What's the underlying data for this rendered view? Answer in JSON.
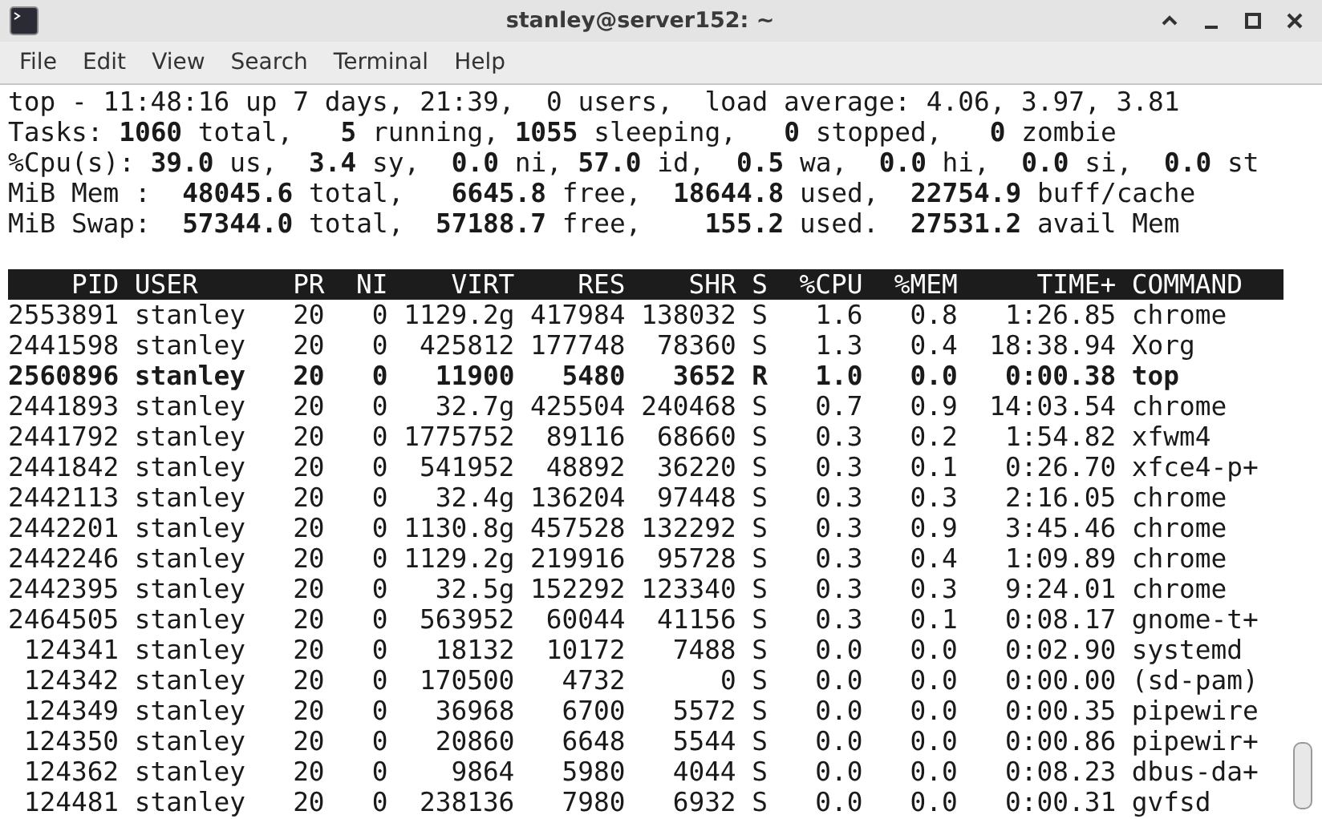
{
  "window": {
    "title": "stanley@server152: ~"
  },
  "menu": [
    "File",
    "Edit",
    "View",
    "Search",
    "Terminal",
    "Help"
  ],
  "summary": [
    "top - 11:48:16 up 7 days, 21:39,  0 users,  load average: 4.06, 3.97, 3.81",
    "Tasks: **1060** total,   **5** running, **1055** sleeping,   **0** stopped,   **0** zombie",
    "%Cpu(s): **39.0** us,  **3.4** sy,  **0.0** ni, **57.0** id,  **0.5** wa,  **0.0** hi,  **0.0** si,  **0.0** st",
    "MiB Mem :  **48045.6** total,   **6645.8** free,  **18644.8** used,  **22754.9** buff/cache",
    "MiB Swap:  **57344.0** total,  **57188.7** free,    **155.2** used.  **27531.2** avail Mem"
  ],
  "table": {
    "columns": [
      "PID",
      "USER",
      "PR",
      "NI",
      "VIRT",
      "RES",
      "SHR",
      "S",
      "%CPU",
      "%MEM",
      "TIME+",
      "COMMAND"
    ],
    "rows": [
      {
        "highlighted": false,
        "cells": [
          "2553891",
          "stanley",
          "20",
          "0",
          "1129.2g",
          "417984",
          "138032",
          "S",
          "1.6",
          "0.8",
          "1:26.85",
          "chrome"
        ]
      },
      {
        "highlighted": false,
        "cells": [
          "2441598",
          "stanley",
          "20",
          "0",
          "425812",
          "177748",
          "78360",
          "S",
          "1.3",
          "0.4",
          "18:38.94",
          "Xorg"
        ]
      },
      {
        "highlighted": true,
        "cells": [
          "2560896",
          "stanley",
          "20",
          "0",
          "11900",
          "5480",
          "3652",
          "R",
          "1.0",
          "0.0",
          "0:00.38",
          "top"
        ]
      },
      {
        "highlighted": false,
        "cells": [
          "2441893",
          "stanley",
          "20",
          "0",
          "32.7g",
          "425504",
          "240468",
          "S",
          "0.7",
          "0.9",
          "14:03.54",
          "chrome"
        ]
      },
      {
        "highlighted": false,
        "cells": [
          "2441792",
          "stanley",
          "20",
          "0",
          "1775752",
          "89116",
          "68660",
          "S",
          "0.3",
          "0.2",
          "1:54.82",
          "xfwm4"
        ]
      },
      {
        "highlighted": false,
        "cells": [
          "2441842",
          "stanley",
          "20",
          "0",
          "541952",
          "48892",
          "36220",
          "S",
          "0.3",
          "0.1",
          "0:26.70",
          "xfce4-p+"
        ]
      },
      {
        "highlighted": false,
        "cells": [
          "2442113",
          "stanley",
          "20",
          "0",
          "32.4g",
          "136204",
          "97448",
          "S",
          "0.3",
          "0.3",
          "2:16.05",
          "chrome"
        ]
      },
      {
        "highlighted": false,
        "cells": [
          "2442201",
          "stanley",
          "20",
          "0",
          "1130.8g",
          "457528",
          "132292",
          "S",
          "0.3",
          "0.9",
          "3:45.46",
          "chrome"
        ]
      },
      {
        "highlighted": false,
        "cells": [
          "2442246",
          "stanley",
          "20",
          "0",
          "1129.2g",
          "219916",
          "95728",
          "S",
          "0.3",
          "0.4",
          "1:09.89",
          "chrome"
        ]
      },
      {
        "highlighted": false,
        "cells": [
          "2442395",
          "stanley",
          "20",
          "0",
          "32.5g",
          "152292",
          "123340",
          "S",
          "0.3",
          "0.3",
          "9:24.01",
          "chrome"
        ]
      },
      {
        "highlighted": false,
        "cells": [
          "2464505",
          "stanley",
          "20",
          "0",
          "563952",
          "60044",
          "41156",
          "S",
          "0.3",
          "0.1",
          "0:08.17",
          "gnome-t+"
        ]
      },
      {
        "highlighted": false,
        "cells": [
          "124341",
          "stanley",
          "20",
          "0",
          "18132",
          "10172",
          "7488",
          "S",
          "0.0",
          "0.0",
          "0:02.90",
          "systemd"
        ]
      },
      {
        "highlighted": false,
        "cells": [
          "124342",
          "stanley",
          "20",
          "0",
          "170500",
          "4732",
          "0",
          "S",
          "0.0",
          "0.0",
          "0:00.00",
          "(sd-pam)"
        ]
      },
      {
        "highlighted": false,
        "cells": [
          "124349",
          "stanley",
          "20",
          "0",
          "36968",
          "6700",
          "5572",
          "S",
          "0.0",
          "0.0",
          "0:00.35",
          "pipewire"
        ]
      },
      {
        "highlighted": false,
        "cells": [
          "124350",
          "stanley",
          "20",
          "0",
          "20860",
          "6648",
          "5544",
          "S",
          "0.0",
          "0.0",
          "0:00.86",
          "pipewir+"
        ]
      },
      {
        "highlighted": false,
        "cells": [
          "124362",
          "stanley",
          "20",
          "0",
          "9864",
          "5980",
          "4044",
          "S",
          "0.0",
          "0.0",
          "0:08.23",
          "dbus-da+"
        ]
      },
      {
        "highlighted": false,
        "cells": [
          "124481",
          "stanley",
          "20",
          "0",
          "238136",
          "7980",
          "6932",
          "S",
          "0.0",
          "0.0",
          "0:00.31",
          "gvfsd"
        ]
      }
    ]
  }
}
